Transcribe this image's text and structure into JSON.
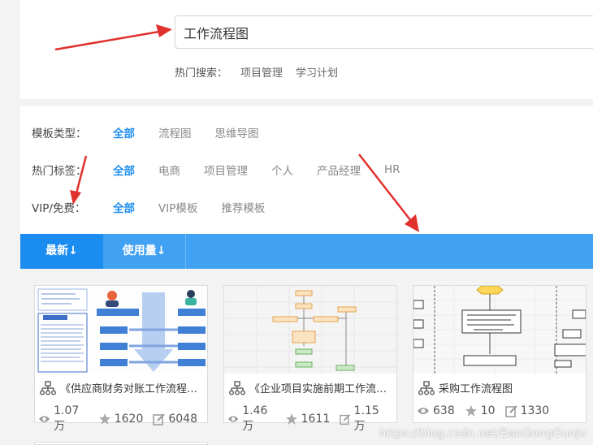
{
  "search": {
    "value": "工作流程图"
  },
  "hot": {
    "label": "热门搜索：",
    "items": [
      "项目管理",
      "学习计划"
    ]
  },
  "filters": {
    "type": {
      "label": "模板类型：",
      "options": [
        "全部",
        "流程图",
        "思维导图"
      ]
    },
    "tags": {
      "label": "热门标签：",
      "options": [
        "全部",
        "电商",
        "项目管理",
        "个人",
        "产品经理",
        "HR"
      ]
    },
    "vip": {
      "label": "VIP/免费：",
      "options": [
        "全部",
        "VIP模板",
        "推荐模板"
      ]
    }
  },
  "sort": {
    "newest": "最新↓",
    "usage": "使用量↓"
  },
  "cards": [
    {
      "title": "《供应商财务对账工作流程图》",
      "views": "1.07万",
      "stars": "1620",
      "edits": "6048"
    },
    {
      "title": "《企业项目实施前期工作流程图...",
      "views": "1.46万",
      "stars": "1611",
      "edits": "1.15万"
    },
    {
      "title": "采购工作流程图",
      "views": "638",
      "stars": "10",
      "edits": "1330"
    }
  ],
  "watermark": "https://blog.csdn.net/BanGongGunJu",
  "colors": {
    "accent": "#1f8ff0",
    "sortbar": "#41a2f4",
    "annotation_arrow": "#e0312d"
  }
}
